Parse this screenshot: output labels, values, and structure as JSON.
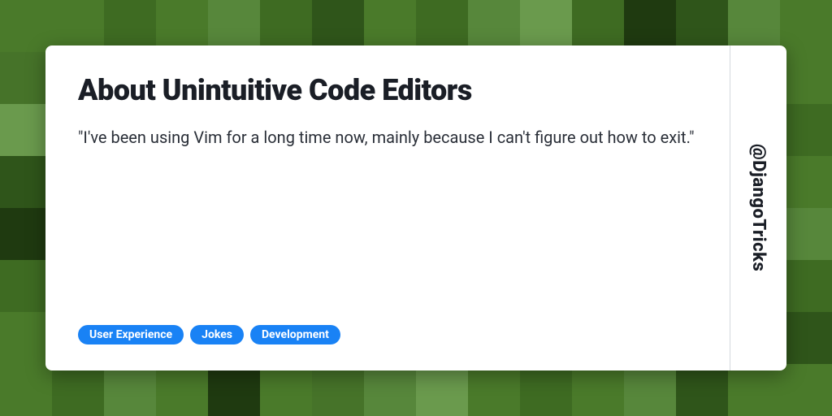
{
  "title": "About Unintuitive Code Editors",
  "quote": "\"I've been using Vim for a long time now, mainly because I can't figure out how to exit.\"",
  "tags": [
    "User Experience",
    "Jokes",
    "Development"
  ],
  "handle": "@DjangoTricks"
}
